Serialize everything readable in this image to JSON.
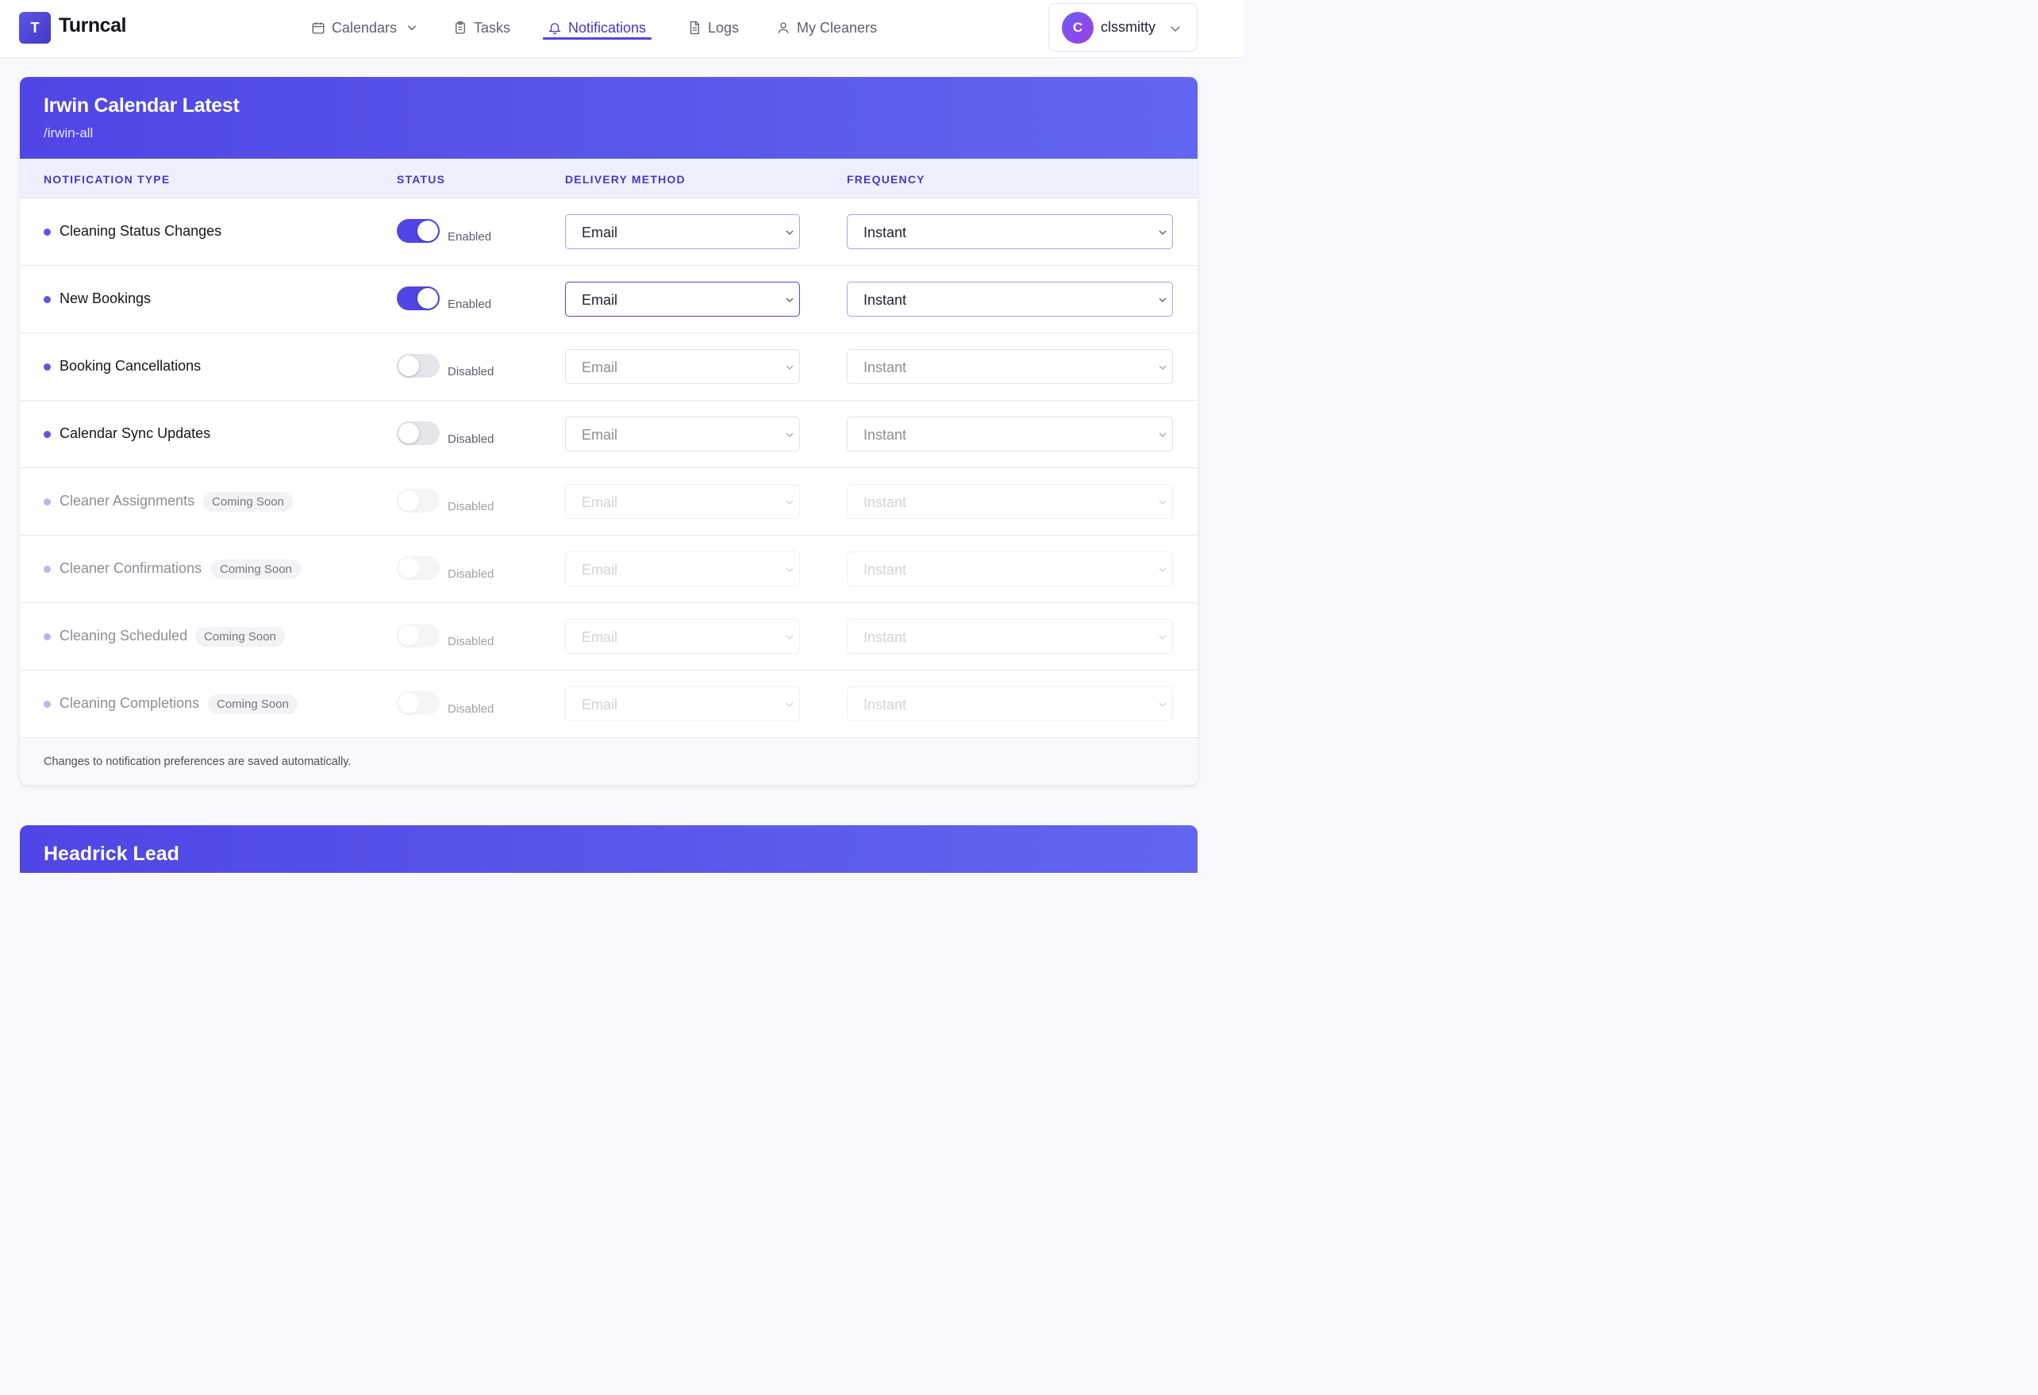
{
  "app": {
    "logo_letter": "T",
    "name": "Turncal"
  },
  "nav": {
    "calendars": "Calendars",
    "tasks": "Tasks",
    "notifications": "Notifications",
    "logs": "Logs",
    "cleaners": "My Cleaners",
    "active": "Notifications"
  },
  "user": {
    "initial": "C",
    "name": "clssmitty"
  },
  "card": {
    "title": "Irwin Calendar Latest",
    "slug": "/irwin-all",
    "headers": {
      "type": "NOTIFICATION TYPE",
      "status": "STATUS",
      "delivery": "DELIVERY METHOD",
      "frequency": "FREQUENCY"
    },
    "rows": [
      {
        "label": "Cleaning Status Changes",
        "badge": "",
        "status": "Enabled",
        "enabled": true,
        "delivery": "Email",
        "frequency": "Instant"
      },
      {
        "label": "New Bookings",
        "badge": "",
        "status": "Enabled",
        "enabled": true,
        "delivery": "Email",
        "frequency": "Instant"
      },
      {
        "label": "Booking Cancellations",
        "badge": "",
        "status": "Disabled",
        "enabled": false,
        "delivery": "Email",
        "frequency": "Instant"
      },
      {
        "label": "Calendar Sync Updates",
        "badge": "",
        "status": "Disabled",
        "enabled": false,
        "delivery": "Email",
        "frequency": "Instant"
      },
      {
        "label": "Cleaner Assignments",
        "badge": "Coming Soon",
        "status": "Disabled",
        "enabled": false,
        "delivery": "Email",
        "frequency": "Instant"
      },
      {
        "label": "Cleaner Confirmations",
        "badge": "Coming Soon",
        "status": "Disabled",
        "enabled": false,
        "delivery": "Email",
        "frequency": "Instant"
      },
      {
        "label": "Cleaning Scheduled",
        "badge": "Coming Soon",
        "status": "Disabled",
        "enabled": false,
        "delivery": "Email",
        "frequency": "Instant"
      },
      {
        "label": "Cleaning Completions",
        "badge": "Coming Soon",
        "status": "Disabled",
        "enabled": false,
        "delivery": "Email",
        "frequency": "Instant"
      }
    ],
    "footer": "Changes to notification preferences are saved automatically."
  },
  "card2": {
    "title": "Headrick Lead"
  },
  "icons": {
    "calendars": "calendar-icon",
    "tasks": "clipboard-icon",
    "notifications": "bell-icon",
    "logs": "document-icon",
    "cleaners": "user-icon"
  },
  "colors": {
    "accent": "#4f46e5",
    "accent_light": "#6366f1",
    "header_bg": "#eef1fd"
  }
}
